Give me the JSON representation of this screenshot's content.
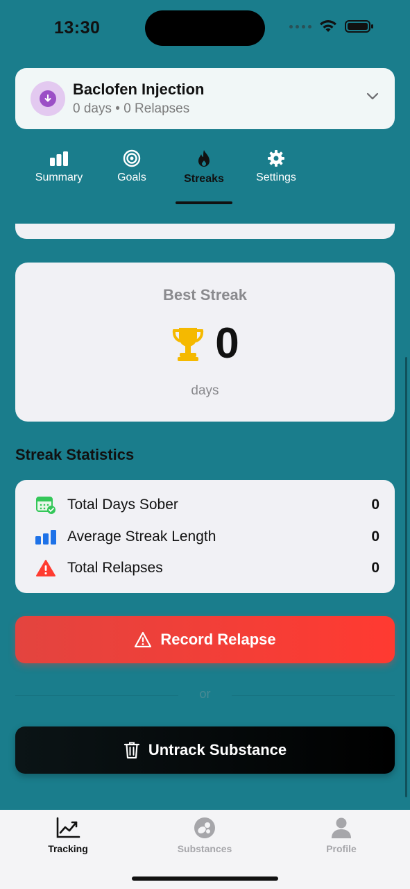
{
  "status_bar": {
    "time": "13:30"
  },
  "substance": {
    "name": "Baclofen Injection",
    "meta": "0 days • 0 Relapses"
  },
  "tabs": [
    {
      "label": "Summary",
      "icon": "bar-chart-icon"
    },
    {
      "label": "Goals",
      "icon": "target-icon"
    },
    {
      "label": "Streaks",
      "icon": "flame-icon",
      "active": true
    },
    {
      "label": "Settings",
      "icon": "gear-icon"
    }
  ],
  "best_streak": {
    "title": "Best Streak",
    "value": "0",
    "unit": "days"
  },
  "streak_stats": {
    "title": "Streak Statistics",
    "rows": [
      {
        "label": "Total Days Sober",
        "value": "0",
        "icon": "calendar-check-icon"
      },
      {
        "label": "Average Streak Length",
        "value": "0",
        "icon": "bar-chart-icon"
      },
      {
        "label": "Total Relapses",
        "value": "0",
        "icon": "warning-icon"
      }
    ]
  },
  "actions": {
    "record_relapse": "Record Relapse",
    "divider": "or",
    "untrack": "Untrack Substance"
  },
  "bottom_nav": [
    {
      "label": "Tracking",
      "icon": "trend-chart-icon",
      "active": true
    },
    {
      "label": "Substances",
      "icon": "pills-icon"
    },
    {
      "label": "Profile",
      "icon": "person-icon"
    }
  ],
  "colors": {
    "background": "#1a7d8c",
    "relapse": "#ff3a31",
    "untrack": "#000000",
    "substance_accent": "#9b4fc6"
  }
}
